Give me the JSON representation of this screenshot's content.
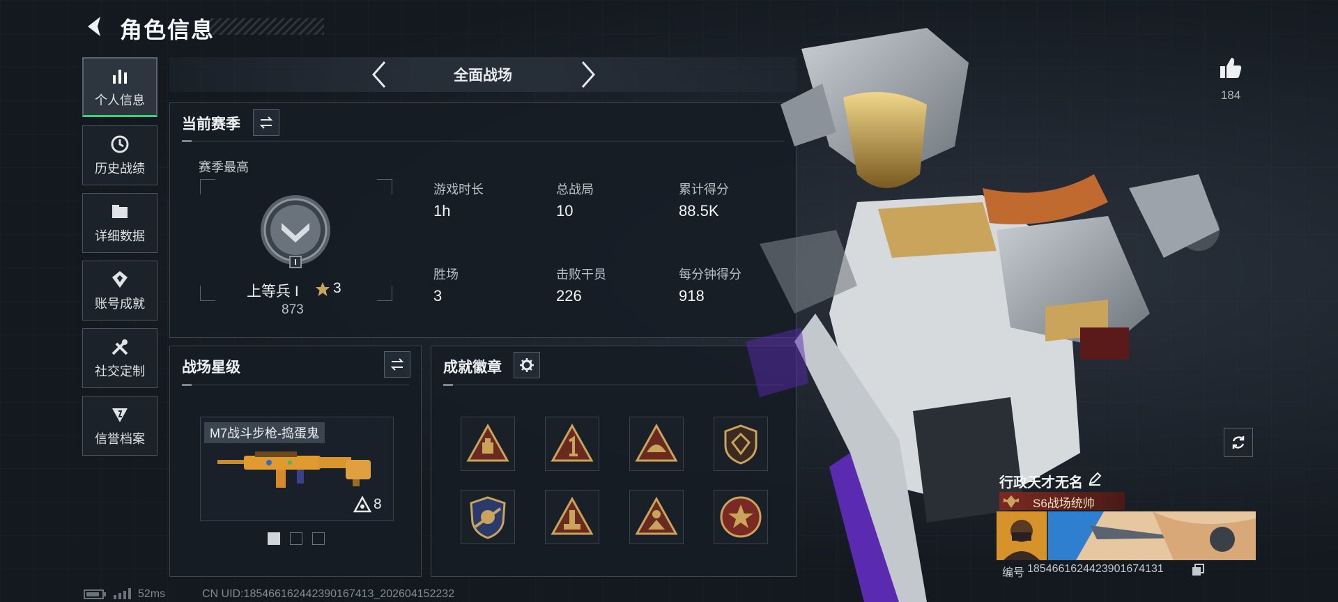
{
  "header": {
    "title": "角色信息"
  },
  "sidebar": {
    "items": [
      {
        "label": "个人信息",
        "icon": "bar-chart-icon",
        "active": true
      },
      {
        "label": "历史战绩",
        "icon": "history-icon"
      },
      {
        "label": "详细数据",
        "icon": "folder-icon"
      },
      {
        "label": "账号成就",
        "icon": "achievement-icon"
      },
      {
        "label": "社交定制",
        "icon": "tools-icon"
      },
      {
        "label": "信誉档案",
        "icon": "reputation-icon"
      }
    ]
  },
  "mode": {
    "title": "全面战场"
  },
  "season": {
    "heading": "当前赛季",
    "best_label": "赛季最高",
    "rank_name": "上等兵 I",
    "stars": "3",
    "score": "873",
    "stats": [
      {
        "label": "游戏时长",
        "value": "1h"
      },
      {
        "label": "总战局",
        "value": "10"
      },
      {
        "label": "累计得分",
        "value": "88.5K"
      },
      {
        "label": "胜场",
        "value": "3"
      },
      {
        "label": "击败干员",
        "value": "226"
      },
      {
        "label": "每分钟得分",
        "value": "918"
      }
    ]
  },
  "battlefield_star": {
    "heading": "战场星级",
    "weapon_name": "M7战斗步枪-捣蛋鬼",
    "weapon_level": "8"
  },
  "badges": {
    "heading": "成就徽章",
    "count": 8
  },
  "player": {
    "likes": "184",
    "name": "行政天才无名",
    "title": "S6战场统帅",
    "id_label": "编号",
    "id": "1854661624423901674131"
  },
  "footer": {
    "ping": "52ms",
    "uid": "CN UID:1854661624423901674​13_202604152232"
  },
  "colors": {
    "accent_green": "#3ad27a",
    "gold": "#c9a45a",
    "panel_border": "#3d4650"
  }
}
